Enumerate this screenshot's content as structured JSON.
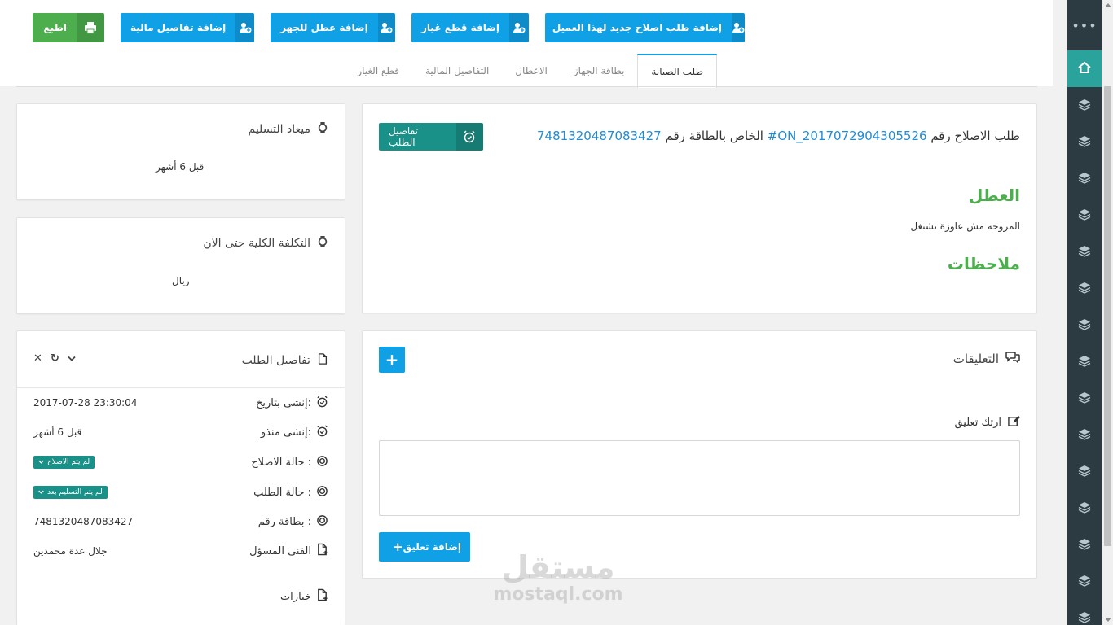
{
  "toolbar": {
    "add_repair_request": "إضافة طلب اصلاح جديد لهذا العميل",
    "add_spare_parts": "إضافة قطع غيار",
    "add_device_fault": "إضافة عطل للجهز",
    "add_financial_details": "إضافة تفاصيل مالية",
    "print": "اطبع"
  },
  "tabs": [
    {
      "label": "طلب الصيانة",
      "active": true
    },
    {
      "label": "بطاقة الجهاز",
      "active": false
    },
    {
      "label": "الاعطال",
      "active": false
    },
    {
      "label": "التفاصيل المالية",
      "active": false
    },
    {
      "label": "قطع الغيار",
      "active": false
    }
  ],
  "request": {
    "title_prefix": "طلب الاصلاح رقم",
    "request_number": "#ON_2017072904305526",
    "title_middle": "الخاص بالطاقة رقم",
    "card_number": "7481320487083427",
    "details_button": "تفاصيل الطلب",
    "fault_heading": "العطل",
    "fault_text": "المروحة مش عاوزة تشتغل",
    "notes_heading": "ملاحظات"
  },
  "delivery": {
    "title": "ميعاد التسليم",
    "value": "قبل 6 أشهر"
  },
  "total_cost": {
    "title": "التكلفة الكلية حتى الان",
    "value": "ريال"
  },
  "comments": {
    "title": "التعليقات",
    "leave_comment": "ارتك تعليق",
    "textarea_placeholder": "",
    "submit_label": "إضافة تعليق"
  },
  "order_details": {
    "title": "تفاصيل الطلب",
    "rows": [
      {
        "label": "إنشى بتاريخ:",
        "value": "2017-07-28 23:30:04"
      },
      {
        "label": "إنشى منذو:",
        "value": "قبل 6 أشهر"
      },
      {
        "label": "حالة الاصلاح :",
        "value": "لم يتم الاصلاح"
      },
      {
        "label": "حالة الطلب :",
        "value": "لم يتم التسليم بعد"
      },
      {
        "label": "بطاقة رقم :",
        "value": "7481320487083427"
      },
      {
        "label": "الفنى المسؤل",
        "value": "جلال عدة محمدين"
      },
      {
        "label": "خيارات",
        "value": ""
      }
    ]
  },
  "colors": {
    "primary": "#10a0e6",
    "success": "#4cae4c",
    "teal": "#1a9188",
    "sidebar": "#2c3b41"
  },
  "watermark": {
    "arabic": "مستقل",
    "latin": "mostaql.com"
  }
}
